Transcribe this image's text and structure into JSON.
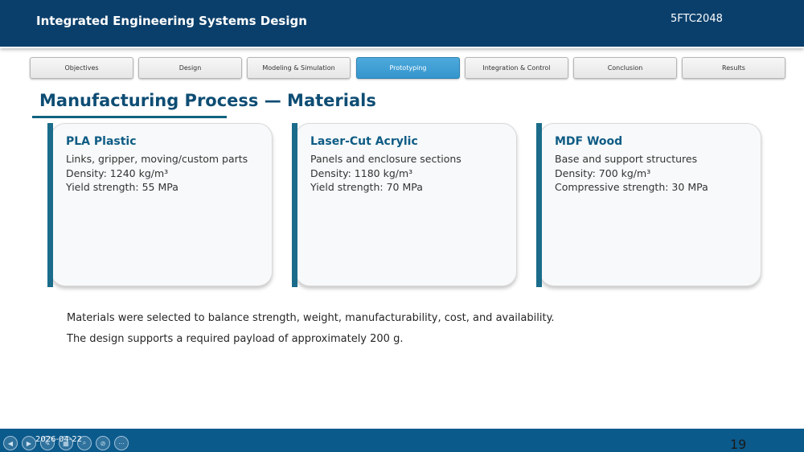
{
  "header": {
    "title": "Integrated Engineering Systems Design",
    "course_code": "5FTC2048"
  },
  "tabs": [
    {
      "label": "Objectives",
      "active": false
    },
    {
      "label": "Design",
      "active": false
    },
    {
      "label": "Modeling & Simulation",
      "active": false
    },
    {
      "label": "Prototyping",
      "active": true
    },
    {
      "label": "Integration & Control",
      "active": false
    },
    {
      "label": "Conclusion",
      "active": false
    },
    {
      "label": "Results",
      "active": false
    }
  ],
  "section_title": "Manufacturing Process — Materials",
  "cards": [
    {
      "title": "PLA Plastic",
      "lines": [
        "Links, gripper, moving/custom parts",
        "Density: 1240 kg/m³",
        "Yield strength: 55 MPa"
      ]
    },
    {
      "title": "Laser-Cut Acrylic",
      "lines": [
        "Panels and enclosure sections",
        "Density: 1180 kg/m³",
        "Yield strength: 70 MPa"
      ]
    },
    {
      "title": "MDF Wood",
      "lines": [
        "Base and support structures",
        "Density: 700 kg/m³",
        "Compressive strength: 30 MPa"
      ]
    }
  ],
  "notes": [
    "Materials were selected to balance strength, weight, manufacturability, cost, and availability.",
    "The design supports a required payload of approximately 200 g."
  ],
  "footer": {
    "date": "2026-04-22",
    "page_number": "19",
    "nav_icons": [
      "previous-slide-icon",
      "next-slide-icon",
      "pen-icon",
      "slides-grid-icon",
      "zoom-icon",
      "subtitles-off-icon",
      "more-options-icon"
    ]
  },
  "colors": {
    "header_bg": "#0b3f6b",
    "accent_tab": "#3a9dd3",
    "title_color": "#0e4d74",
    "card_bar": "#1a6c8a",
    "footer_bg": "#0b5a8c"
  }
}
